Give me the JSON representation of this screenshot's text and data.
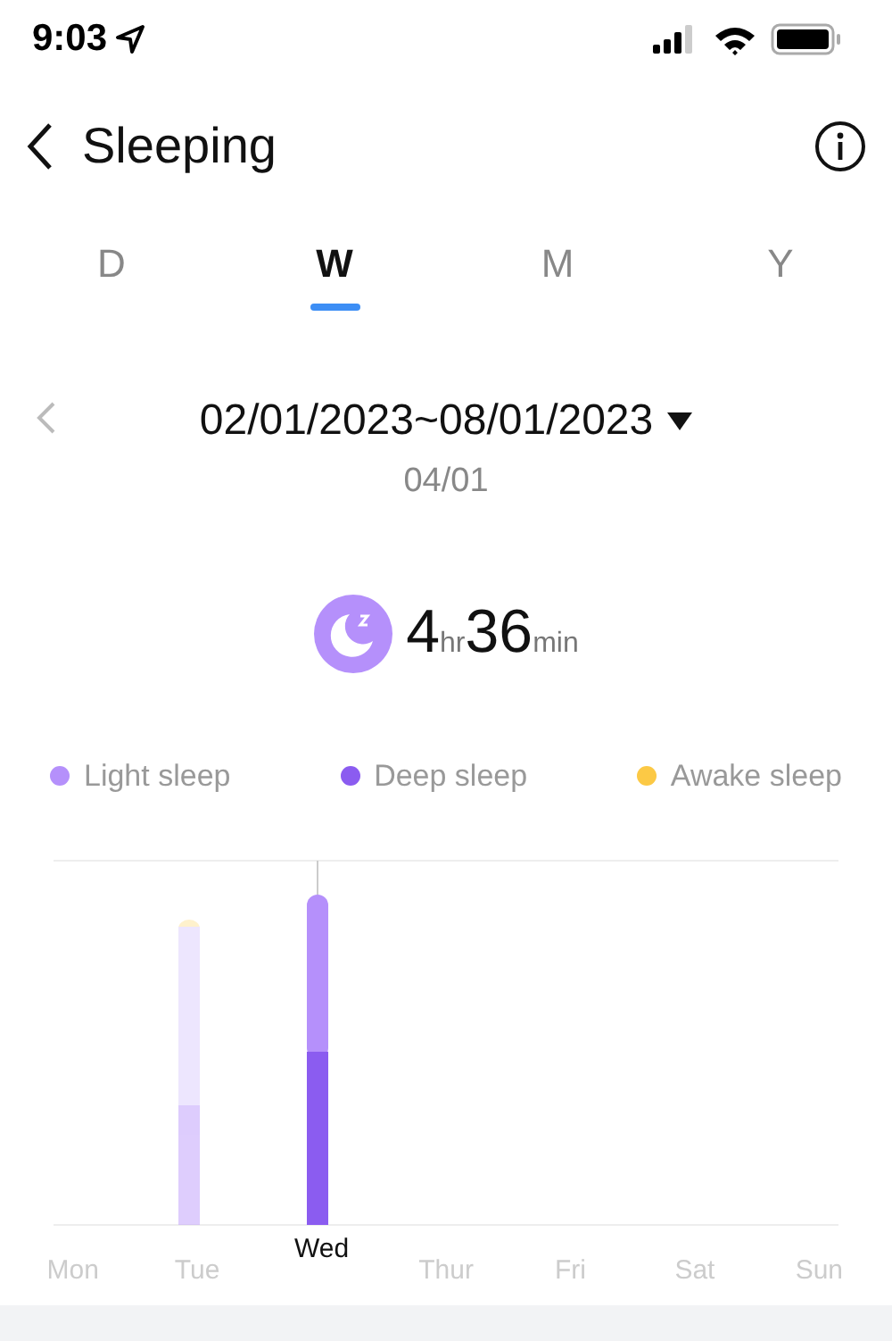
{
  "status_bar": {
    "time": "9:03"
  },
  "header": {
    "title": "Sleeping"
  },
  "tabs": [
    {
      "label": "D",
      "selected": false
    },
    {
      "label": "W",
      "selected": true
    },
    {
      "label": "M",
      "selected": false
    },
    {
      "label": "Y",
      "selected": false
    }
  ],
  "date_range": {
    "label": "02/01/2023~08/01/2023",
    "selected_day": "04/01"
  },
  "summary": {
    "hours": "4",
    "hours_unit": "hr",
    "minutes": "36",
    "minutes_unit": "min"
  },
  "legend": [
    {
      "label": "Light sleep",
      "color": "#b590fb"
    },
    {
      "label": "Deep sleep",
      "color": "#8b5cf0"
    },
    {
      "label": "Awake sleep",
      "color": "#fcc945"
    }
  ],
  "days": [
    {
      "label": "Mon",
      "selected": false
    },
    {
      "label": "Tue",
      "selected": false
    },
    {
      "label": "Wed",
      "selected": true
    },
    {
      "label": "Thur",
      "selected": false
    },
    {
      "label": "Fri",
      "selected": false
    },
    {
      "label": "Sat",
      "selected": false
    },
    {
      "label": "Sun",
      "selected": false
    }
  ]
}
